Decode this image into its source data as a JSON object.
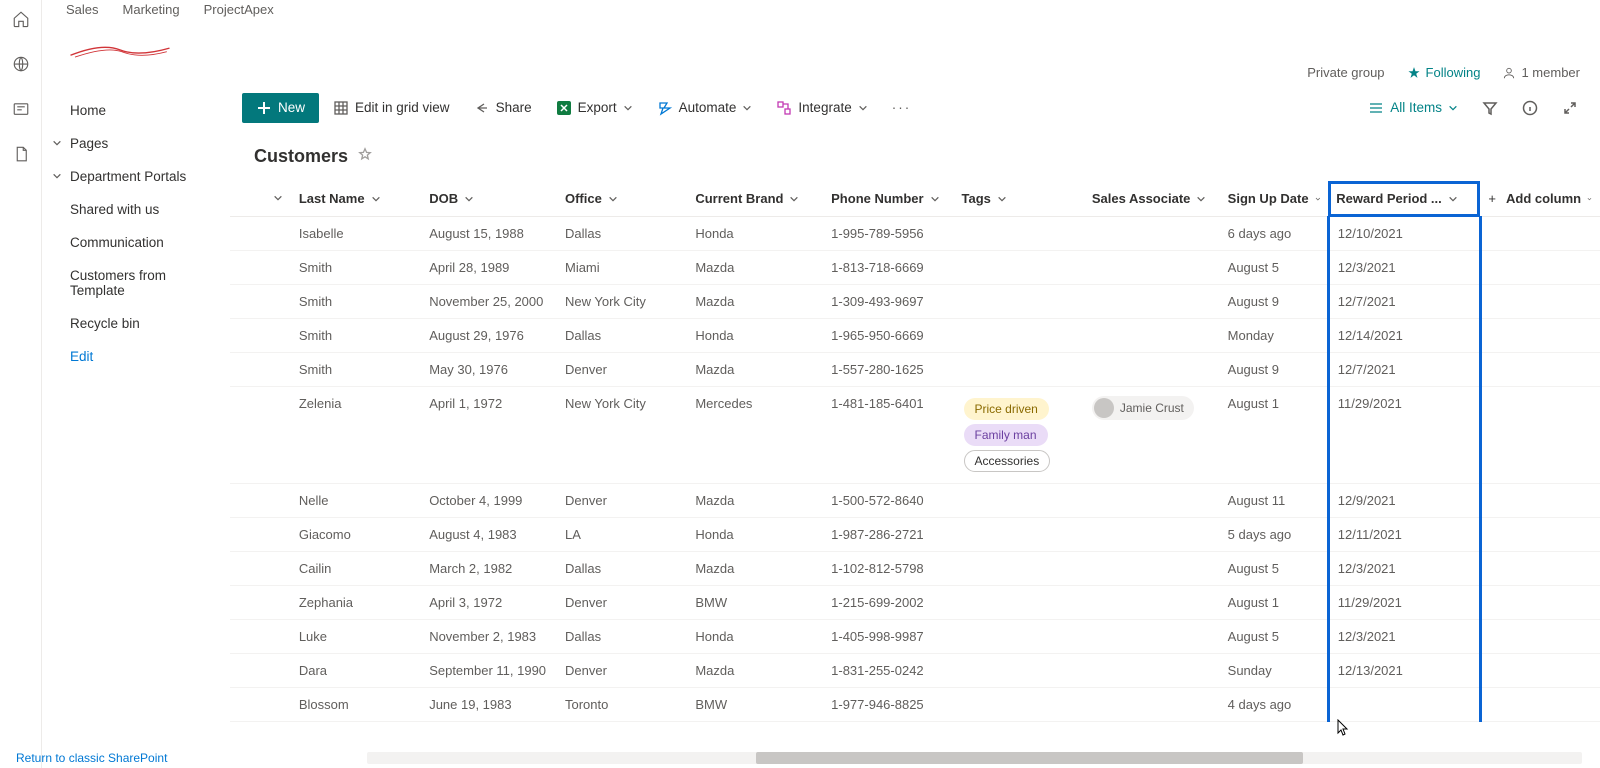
{
  "tabs": [
    "Sales",
    "Marketing",
    "ProjectApex"
  ],
  "status": {
    "group": "Private group",
    "following": "Following",
    "members": "1 member"
  },
  "nav": {
    "home": "Home",
    "pages": "Pages",
    "dept": "Department Portals",
    "shared": "Shared with us",
    "comm": "Communication",
    "cust": "Customers from Template",
    "recycle": "Recycle bin",
    "edit": "Edit"
  },
  "cmd": {
    "new": "New",
    "editgrid": "Edit in grid view",
    "share": "Share",
    "export": "Export",
    "automate": "Automate",
    "integrate": "Integrate",
    "view": "All Items"
  },
  "list": {
    "title": "Customers"
  },
  "columns": {
    "lastname": "Last Name",
    "dob": "DOB",
    "office": "Office",
    "brand": "Current Brand",
    "phone": "Phone Number",
    "tags": "Tags",
    "assoc": "Sales Associate",
    "signup": "Sign Up Date",
    "reward": "Reward Period ...",
    "add": "Add column"
  },
  "tags": {
    "price": "Price driven",
    "family": "Family man",
    "acc": "Accessories"
  },
  "assoc": {
    "jamie": "Jamie Crust"
  },
  "rows": [
    {
      "lastname": "Isabelle",
      "dob": "August 15, 1988",
      "office": "Dallas",
      "brand": "Honda",
      "phone": "1-995-789-5956",
      "signup": "6 days ago",
      "reward": "12/10/2021"
    },
    {
      "lastname": "Smith",
      "dob": "April 28, 1989",
      "office": "Miami",
      "brand": "Mazda",
      "phone": "1-813-718-6669",
      "signup": "August 5",
      "reward": "12/3/2021"
    },
    {
      "lastname": "Smith",
      "dob": "November 25, 2000",
      "office": "New York City",
      "brand": "Mazda",
      "phone": "1-309-493-9697",
      "signup": "August 9",
      "reward": "12/7/2021"
    },
    {
      "lastname": "Smith",
      "dob": "August 29, 1976",
      "office": "Dallas",
      "brand": "Honda",
      "phone": "1-965-950-6669",
      "signup": "Monday",
      "reward": "12/14/2021"
    },
    {
      "lastname": "Smith",
      "dob": "May 30, 1976",
      "office": "Denver",
      "brand": "Mazda",
      "phone": "1-557-280-1625",
      "signup": "August 9",
      "reward": "12/7/2021"
    },
    {
      "lastname": "Zelenia",
      "dob": "April 1, 1972",
      "office": "New York City",
      "brand": "Mercedes",
      "phone": "1-481-185-6401",
      "signup": "August 1",
      "reward": "11/29/2021",
      "hasTags": true,
      "hasAssoc": true
    },
    {
      "lastname": "Nelle",
      "dob": "October 4, 1999",
      "office": "Denver",
      "brand": "Mazda",
      "phone": "1-500-572-8640",
      "signup": "August 11",
      "reward": "12/9/2021"
    },
    {
      "lastname": "Giacomo",
      "dob": "August 4, 1983",
      "office": "LA",
      "brand": "Honda",
      "phone": "1-987-286-2721",
      "signup": "5 days ago",
      "reward": "12/11/2021"
    },
    {
      "lastname": "Cailin",
      "dob": "March 2, 1982",
      "office": "Dallas",
      "brand": "Mazda",
      "phone": "1-102-812-5798",
      "signup": "August 5",
      "reward": "12/3/2021"
    },
    {
      "lastname": "Zephania",
      "dob": "April 3, 1972",
      "office": "Denver",
      "brand": "BMW",
      "phone": "1-215-699-2002",
      "signup": "August 1",
      "reward": "11/29/2021"
    },
    {
      "lastname": "Luke",
      "dob": "November 2, 1983",
      "office": "Dallas",
      "brand": "Honda",
      "phone": "1-405-998-9987",
      "signup": "August 5",
      "reward": "12/3/2021"
    },
    {
      "lastname": "Dara",
      "dob": "September 11, 1990",
      "office": "Denver",
      "brand": "Mazda",
      "phone": "1-831-255-0242",
      "signup": "Sunday",
      "reward": "12/13/2021"
    },
    {
      "lastname": "Blossom",
      "dob": "June 19, 1983",
      "office": "Toronto",
      "brand": "BMW",
      "phone": "1-977-946-8825",
      "signup": "4 days ago",
      "reward": ""
    }
  ],
  "footer": {
    "classic": "Return to classic SharePoint"
  }
}
